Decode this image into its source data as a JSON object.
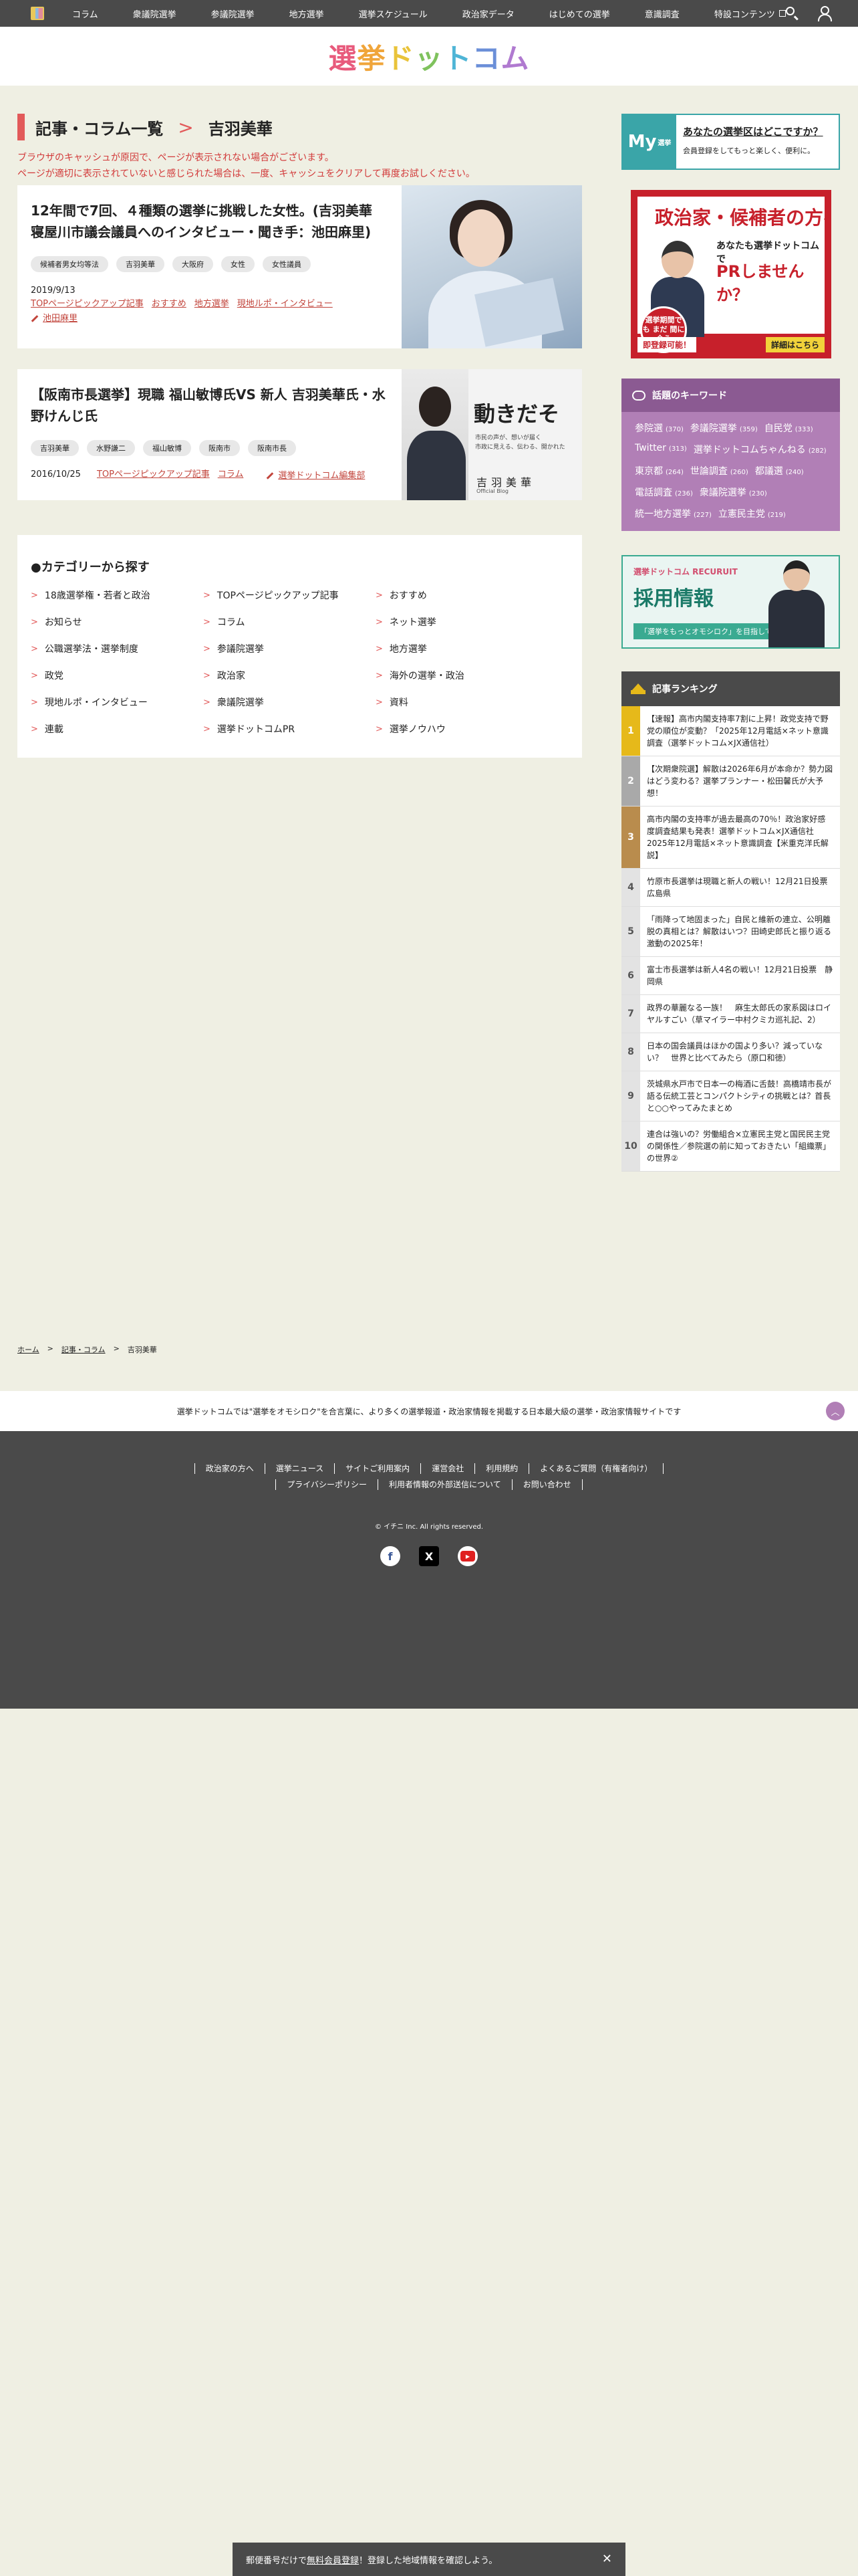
{
  "topnav": {
    "items": [
      "コラム",
      "衆議院選挙",
      "参議院選挙",
      "地方選挙",
      "選挙スケジュール",
      "政治家データ",
      "はじめての選挙",
      "意識調査",
      "特設コンテンツ"
    ]
  },
  "header": {
    "logo": [
      "選",
      "挙",
      "ド",
      "ッ",
      "ト",
      "コ",
      "ム"
    ]
  },
  "page": {
    "section": "記事・コラム一覧",
    "sep": ">",
    "title": "吉羽美華",
    "notice1": "ブラウザのキャッシュが原因で、ページが表示されない場合がございます。",
    "notice2": "ページが適切に表示されていないと感じられた場合は、一度、キャッシュをクリアして再度お試しください。"
  },
  "articles": [
    {
      "title": "12年間で7回、４種類の選挙に挑戦した女性。(吉羽美華 寝屋川市議会議員へのインタビュー・聞き手：池田麻里)",
      "tags": [
        "候補者男女均等法",
        "吉羽美華",
        "大阪府",
        "女性",
        "女性議員"
      ],
      "date": "2019/9/13",
      "cats": [
        "TOPページピックアップ記事",
        "おすすめ",
        "地方選挙",
        "現地ルポ・インタビュー"
      ],
      "author": "池田麻里"
    },
    {
      "title": "【阪南市長選挙】現職 福山敏博氏VS 新人 吉羽美華氏・水野けんじ氏",
      "tags": [
        "吉羽美華",
        "水野謙二",
        "福山敏博",
        "阪南市",
        "阪南市長"
      ],
      "date": "2016/10/25",
      "cats": [
        "TOPページピックアップ記事",
        "コラム"
      ],
      "author": "選挙ドットコム編集部",
      "thumb_big": "動きだそ",
      "thumb_small1": "市民の声が、想いが届く",
      "thumb_small2": "市政に見える、伝わる、開かれた",
      "thumb_name": "吉羽美華",
      "thumb_sub": "Official Blog"
    }
  ],
  "categories": {
    "title": "●カテゴリーから探す",
    "items": [
      "18歳選挙権・若者と政治",
      "TOPページピックアップ記事",
      "おすすめ",
      "お知らせ",
      "コラム",
      "ネット選挙",
      "公職選挙法・選挙制度",
      "参議院選挙",
      "地方選挙",
      "政党",
      "政治家",
      "海外の選挙・政治",
      "現地ルポ・インタビュー",
      "衆議院選挙",
      "資料",
      "連載",
      "選挙ドットコムPR",
      "選挙ノウハウ"
    ]
  },
  "sidebar": {
    "my": "My",
    "my_small": "選挙",
    "my_question": "あなたの選挙区はどこですか？",
    "my_desc": "会員登録をしてもっと楽しく、便利に。",
    "banner1": {
      "title": "政治家・候補者の方へ",
      "line1": "あなたも選挙ドットコムで",
      "line2": "PRしませんか？",
      "badge": "選挙期間でも\nまだ\n間に合う",
      "foot_left": "即登録可能！",
      "foot_right": "詳細はこちら"
    },
    "keywords_title": "話題のキーワード",
    "keywords": [
      {
        "k": "参院選",
        "n": "(370)"
      },
      {
        "k": "参議院選挙",
        "n": "(359)"
      },
      {
        "k": "自民党",
        "n": "(333)"
      },
      {
        "k": "Twitter",
        "n": "(313)"
      },
      {
        "k": "選挙ドットコムちゃんねる",
        "n": "(282)"
      },
      {
        "k": "東京都",
        "n": "(264)"
      },
      {
        "k": "世論調査",
        "n": "(260)"
      },
      {
        "k": "都議選",
        "n": "(240)"
      },
      {
        "k": "電話調査",
        "n": "(236)"
      },
      {
        "k": "衆議院選挙",
        "n": "(230)"
      },
      {
        "k": "統一地方選挙",
        "n": "(227)"
      },
      {
        "k": "立憲民主党",
        "n": "(219)"
      }
    ],
    "banner2": {
      "l1": "選挙ドットコム RECURUIT",
      "l2": "採用情報",
      "l3": "「選挙をもっとオモシロク」を目指して"
    },
    "ranking_title": "記事ランキング",
    "ranking": [
      "【速報】高市内閣支持率7割に上昇！政党支持で野党の順位が変動？「2025年12月電話×ネット意識調査（選挙ドットコム×JX通信社）",
      "【次期衆院選】解散は2026年6月が本命か？勢力図はどう変わる？選挙プランナー・松田馨氏が大予想！",
      "高市内閣の支持率が過去最高の70％！政治家好感度調査結果も発表！選挙ドットコム×JX通信社2025年12月電話×ネット意識調査【米重克洋氏解説】",
      "竹原市長選挙は現職と新人の戦い！12月21日投票　広島県",
      "「雨降って地固まった」自民と維新の連立、公明離脱の真相とは？解散はいつ？田崎史郎氏と振り返る激動の2025年！",
      "富士市長選挙は新人4名の戦い！12月21日投票　静岡県",
      "政界の華麗なる一族！　麻生太郎氏の家系図はロイヤルすごい（草マイラー中村クミカ巡礼記、2）",
      "日本の国会議員はほかの国より多い？減っていない？　世界と比べてみたら（原口和徳）",
      "茨城県水戸市で日本一の梅酒に舌鼓！高橋靖市長が語る伝統工芸とコンパクトシティの挑戦とは？首長と○○やってみたまとめ",
      "連合は強いの？労働組合×立憲民主党と国民民主党の関係性／参院選の前に知っておきたい「組織票」の世界②"
    ]
  },
  "breadcrumb": [
    "ホーム",
    "記事・コラム",
    "吉羽美華"
  ],
  "footer": {
    "tagline": "選挙ドットコムでは\"選挙をオモシロク\"を合言葉に、より多くの選挙報道・政治家情報を掲載する日本最大級の選挙・政治家情報サイトです",
    "row1": [
      "政治家の方へ",
      "選挙ニュース",
      "サイトご利用案内",
      "運営会社",
      "利用規約",
      "よくあるご質問（有権者向け）"
    ],
    "row2": [
      "プライバシーポリシー",
      "利用者情報の外部送信について",
      "お問い合わせ"
    ],
    "copyright": "© イチニ Inc. All rights reserved."
  },
  "bottombar": {
    "pre": "郵便番号だけで",
    "link": "無料会員登録",
    "post": "！登録した地域情報を確認しよう。",
    "close": "✕"
  }
}
